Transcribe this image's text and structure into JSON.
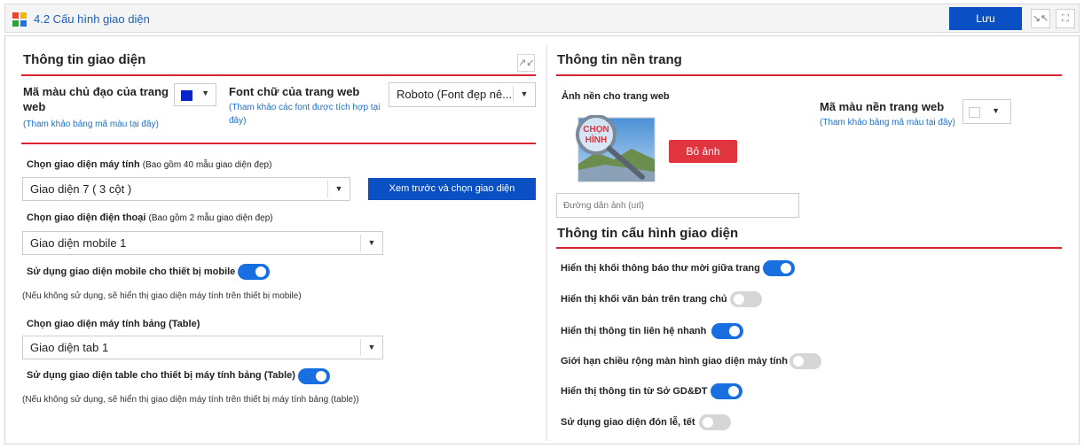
{
  "header": {
    "title": "4.2 Cấu hình giao diện",
    "save_label": "Lưu",
    "logo_colors": [
      "#e8442e",
      "#f5b400",
      "#2f9e44",
      "#1a73e8"
    ]
  },
  "left": {
    "section_title": "Thông tin giao diện",
    "primary_color": {
      "label": "Mã màu chủ đạo của trang web",
      "hint": "(Tham khảo bảng mã màu tại đây)",
      "value": "#0b24c9"
    },
    "font": {
      "label": "Font chữ của trang web",
      "hint": "(Tham khảo các font được tích hợp tại đây)",
      "value": "Roboto (Font đẹp nê..."
    },
    "desktop": {
      "label_bold": "Chọn giao diện máy tính",
      "label_note": "(Bao gồm 40 mẫu giao diện đẹp)",
      "value": "Giao diện 7 ( 3 cột )",
      "preview_button": "Xem trước và chọn giao diện"
    },
    "mobile": {
      "label_bold": "Chọn giao diện điện thoại",
      "label_note": "(Bao gồm 2 mẫu giao diện đẹp)",
      "value": "Giao diện mobile 1",
      "toggle_label": "Sử dụng giao diện mobile cho thiết bị mobile",
      "toggle_on": true,
      "note": "(Nếu không sử dụng, sẽ hiển thị giao diện máy tính trên thiết bị mobile)"
    },
    "tablet": {
      "label_bold": "Chọn giao diện máy tính bảng (Table)",
      "value": "Giao diện tab 1",
      "toggle_label": "Sử dụng giao diện table cho thiết bị máy tính bảng (Table)",
      "toggle_on": true,
      "note": "(Nếu không sử dụng, sẽ hiển thị giao diện máy tính trên thiết bị máy tính bảng (table))"
    }
  },
  "right": {
    "background_title": "Thông tin nền trang",
    "bg_image_label": "Ảnh nền cho trang web",
    "bg_image_placeholder_text": "CHỌN HÌNH",
    "remove_image_button": "Bỏ ảnh",
    "url_placeholder": "Đường dẫn ảnh (url)",
    "bg_color_label": "Mã màu nền trang web",
    "bg_color_hint": "(Tham khảo bảng mã màu tại đây)",
    "bg_color_value": "#ffffff",
    "config_title": "Thông tin cấu hình giao diện",
    "toggles": [
      {
        "label": "Hiển thị khối thông báo thư mời giữa trang",
        "on": true
      },
      {
        "label": "Hiển thị khối văn bản trên trang chủ",
        "on": false
      },
      {
        "label": "Hiển thị thông tin liên hệ nhanh",
        "on": true
      },
      {
        "label": "Giới hạn chiều rộng màn hình giao diện máy tính",
        "on": false
      },
      {
        "label": "Hiển thị thông tin từ Sở GD&ĐT",
        "on": true
      },
      {
        "label": "Sử dụng giao diện đón lễ, tết",
        "on": false
      }
    ]
  },
  "colors": {
    "accent_blue": "#0a4fc4",
    "divider_red": "#d9232e",
    "toggle_on": "#1a6fe0",
    "toggle_off": "#d6d6d6",
    "remove_red": "#e0353f"
  }
}
